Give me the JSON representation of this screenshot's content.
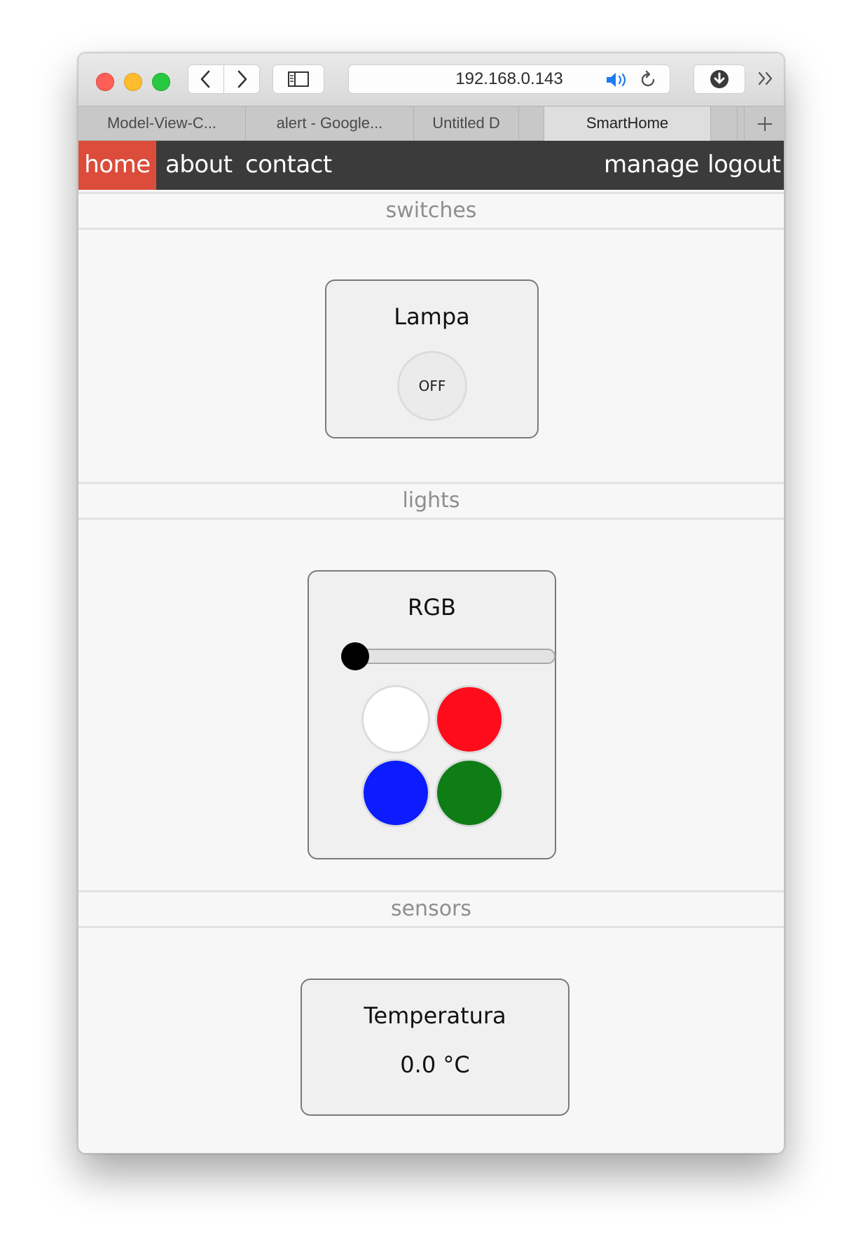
{
  "browser": {
    "url": "192.168.0.143",
    "tabs": [
      {
        "label": "Model-View-C..."
      },
      {
        "label": "alert - Google..."
      },
      {
        "label": "Untitled D"
      },
      {
        "label": "SmartHome"
      }
    ],
    "icons": {
      "close": "close-icon",
      "minimize": "minimize-icon",
      "zoom": "zoom-icon",
      "back": "chevron-left-icon",
      "forward": "chevron-right-icon",
      "sidebar": "sidebar-icon",
      "speaker": "speaker-icon",
      "reload": "reload-icon",
      "download": "download-icon",
      "overflow": "double-chevron-icon",
      "new_tab": "plus-icon"
    }
  },
  "nav": {
    "home": "home",
    "about": "about",
    "contact": "contact",
    "manage": "manage",
    "logout": "logout",
    "active_color": "#db4c3a",
    "bar_color": "#3b3b3b"
  },
  "sections": {
    "switches": {
      "title": "switches",
      "device": {
        "name": "Lampa",
        "state": "OFF"
      }
    },
    "lights": {
      "title": "lights",
      "device": {
        "name": "RGB",
        "brightness": 0,
        "colors": [
          {
            "name": "white",
            "hex": "#ffffff"
          },
          {
            "name": "red",
            "hex": "#fe0c1c"
          },
          {
            "name": "blue",
            "hex": "#0c1cfe"
          },
          {
            "name": "green",
            "hex": "#0f7d15"
          }
        ]
      }
    },
    "sensors": {
      "title": "sensors",
      "device": {
        "name": "Temperatura",
        "value": "0.0 °C"
      }
    }
  }
}
